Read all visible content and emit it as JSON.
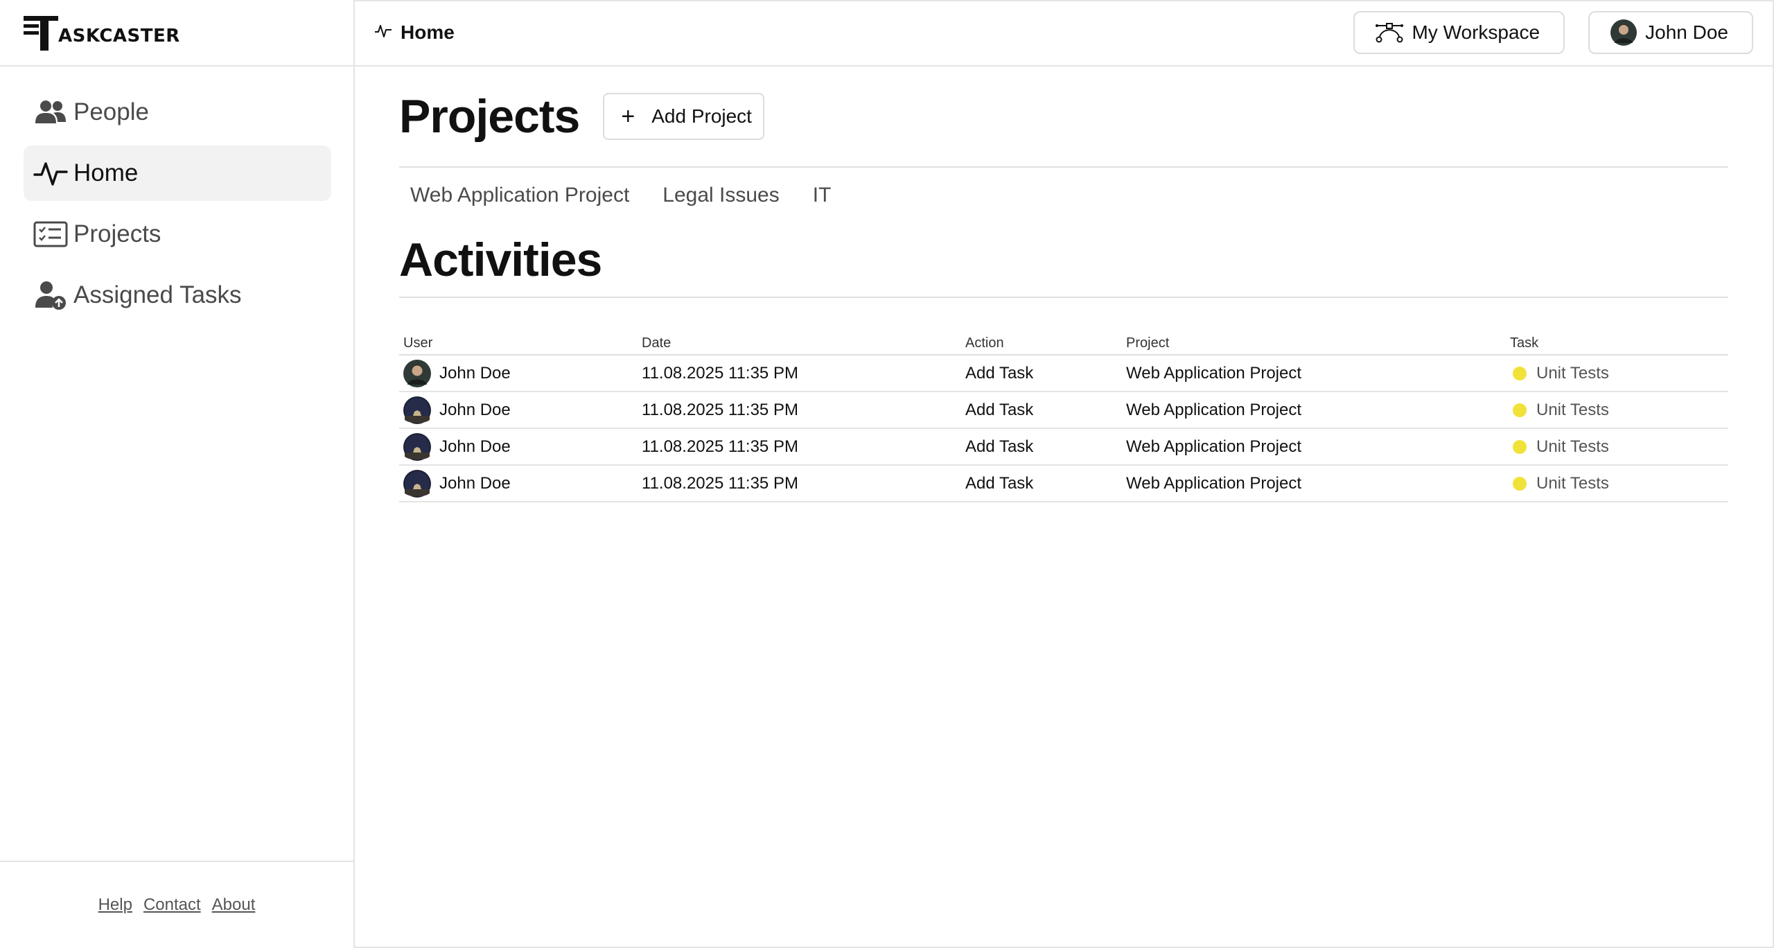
{
  "brand": {
    "logo_text": "ASKCASTER"
  },
  "sidebar": {
    "items": [
      {
        "label": "People",
        "icon": "people-icon",
        "active": false
      },
      {
        "label": "Home",
        "icon": "activity-icon",
        "active": true
      },
      {
        "label": "Projects",
        "icon": "checklist-icon",
        "active": false
      },
      {
        "label": "Assigned Tasks",
        "icon": "user-assigned-icon",
        "active": false
      }
    ],
    "footer_links": [
      "Help",
      "Contact",
      "About"
    ]
  },
  "header": {
    "breadcrumb": "Home",
    "workspace_button": "My Workspace",
    "user_button": "John Doe"
  },
  "projects": {
    "title": "Projects",
    "add_button": "Add Project",
    "tabs": [
      "Web Application Project",
      "Legal Issues",
      "IT"
    ]
  },
  "activities": {
    "title": "Activities",
    "columns": [
      "User",
      "Date",
      "Action",
      "Project",
      "Task"
    ],
    "rows": [
      {
        "user": "John Doe",
        "date": "11.08.2025 11:35 PM",
        "action": "Add Task",
        "project": "Web Application Project",
        "task": "Unit Tests"
      },
      {
        "user": "John Doe",
        "date": "11.08.2025 11:35 PM",
        "action": "Add Task",
        "project": "Web Application Project",
        "task": "Unit Tests"
      },
      {
        "user": "John Doe",
        "date": "11.08.2025 11:35 PM",
        "action": "Add Task",
        "project": "Web Application Project",
        "task": "Unit Tests"
      },
      {
        "user": "John Doe",
        "date": "11.08.2025 11:35 PM",
        "action": "Add Task",
        "project": "Web Application Project",
        "task": "Unit Tests"
      }
    ]
  },
  "colors": {
    "task_status": "#f1e23a",
    "active_nav_bg": "#f2f2f2",
    "border": "#e4e4e4"
  }
}
